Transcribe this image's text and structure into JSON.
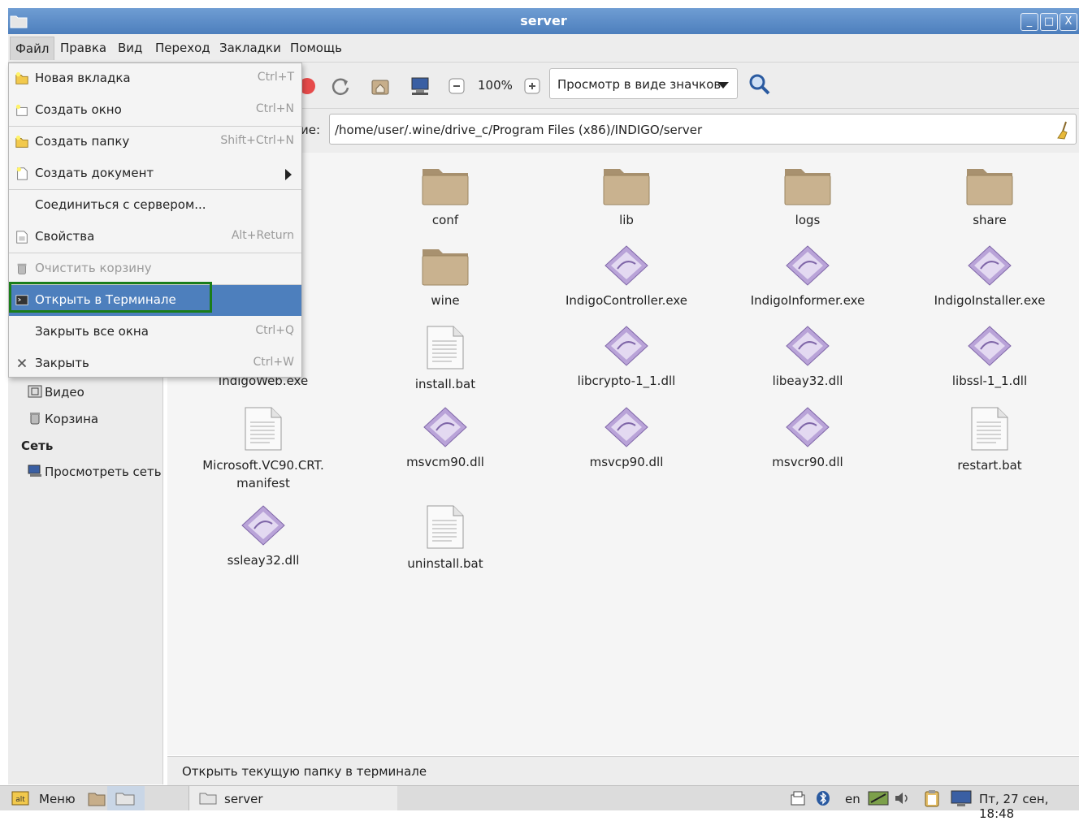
{
  "window": {
    "title": "server",
    "controls": {
      "minimize": "_",
      "maximize": "□",
      "close": "X"
    }
  },
  "menubar": [
    "Файл",
    "Правка",
    "Вид",
    "Переход",
    "Закладки",
    "Помощь"
  ],
  "toolbar": {
    "zoom_level": "100%",
    "view_mode": "Просмотр в виде значков"
  },
  "location": {
    "label": "ие:",
    "path": "/home/user/.wine/drive_c/Program Files (x86)/INDIGO/server"
  },
  "file_menu": [
    {
      "label": "Новая вкладка",
      "shortcut": "Ctrl+T",
      "icon": "new-tab-icon"
    },
    {
      "label": "Создать окно",
      "shortcut": "Ctrl+N",
      "icon": "new-window-icon"
    },
    {
      "label": "Создать папку",
      "shortcut": "Shift+Ctrl+N",
      "icon": "new-folder-icon"
    },
    {
      "label": "Создать документ",
      "shortcut": "",
      "icon": "new-document-icon"
    },
    {
      "label": "Соединиться с сервером...",
      "shortcut": "",
      "icon": ""
    },
    {
      "label": "Свойства",
      "shortcut": "Alt+Return",
      "icon": "properties-icon"
    },
    {
      "label": "Очистить корзину",
      "shortcut": "",
      "icon": "trash-icon",
      "disabled": true
    },
    {
      "label": "Открыть в Терминале",
      "shortcut": "",
      "icon": "terminal-icon",
      "selected": true
    },
    {
      "label": "Закрыть все окна",
      "shortcut": "Ctrl+Q",
      "icon": ""
    },
    {
      "label": "Закрыть",
      "shortcut": "Ctrl+W",
      "icon": "close-icon"
    }
  ],
  "sidebar": {
    "items": [
      "Видео",
      "Корзина"
    ],
    "network_heading": "Сеть",
    "network_items": [
      "Просмотреть сеть"
    ]
  },
  "files": [
    {
      "name": "conf",
      "type": "folder"
    },
    {
      "name": "lib",
      "type": "folder"
    },
    {
      "name": "logs",
      "type": "folder"
    },
    {
      "name": "share",
      "type": "folder"
    },
    {
      "name": "wine",
      "type": "folder"
    },
    {
      "name": "IndigoController.exe",
      "type": "exe"
    },
    {
      "name": "IndigoInformer.exe",
      "type": "exe"
    },
    {
      "name": "IndigoInstaller.exe",
      "type": "exe"
    },
    {
      "name": "IndigoWeb.exe",
      "type": "exe"
    },
    {
      "name": "install.bat",
      "type": "text"
    },
    {
      "name": "libcrypto-1_1.dll",
      "type": "exe"
    },
    {
      "name": "libeay32.dll",
      "type": "exe"
    },
    {
      "name": "libssl-1_1.dll",
      "type": "exe"
    },
    {
      "name": "Microsoft.VC90.CRT.",
      "name2": "manifest",
      "type": "text"
    },
    {
      "name": "msvcm90.dll",
      "type": "exe"
    },
    {
      "name": "msvcp90.dll",
      "type": "exe"
    },
    {
      "name": "msvcr90.dll",
      "type": "exe"
    },
    {
      "name": "restart.bat",
      "type": "text"
    },
    {
      "name": "ssleay32.dll",
      "type": "exe"
    },
    {
      "name": "uninstall.bat",
      "type": "text"
    }
  ],
  "statusbar": "Открыть текущую папку в терминале",
  "taskbar": {
    "menu_label": "Меню",
    "task_label": "server",
    "lang": "en",
    "clock": "Пт, 27 сен, 18:48"
  },
  "colors": {
    "accent": "#4d7fbd",
    "highlight_border": "#1a7d1a",
    "folder": "#c7ae8a"
  }
}
